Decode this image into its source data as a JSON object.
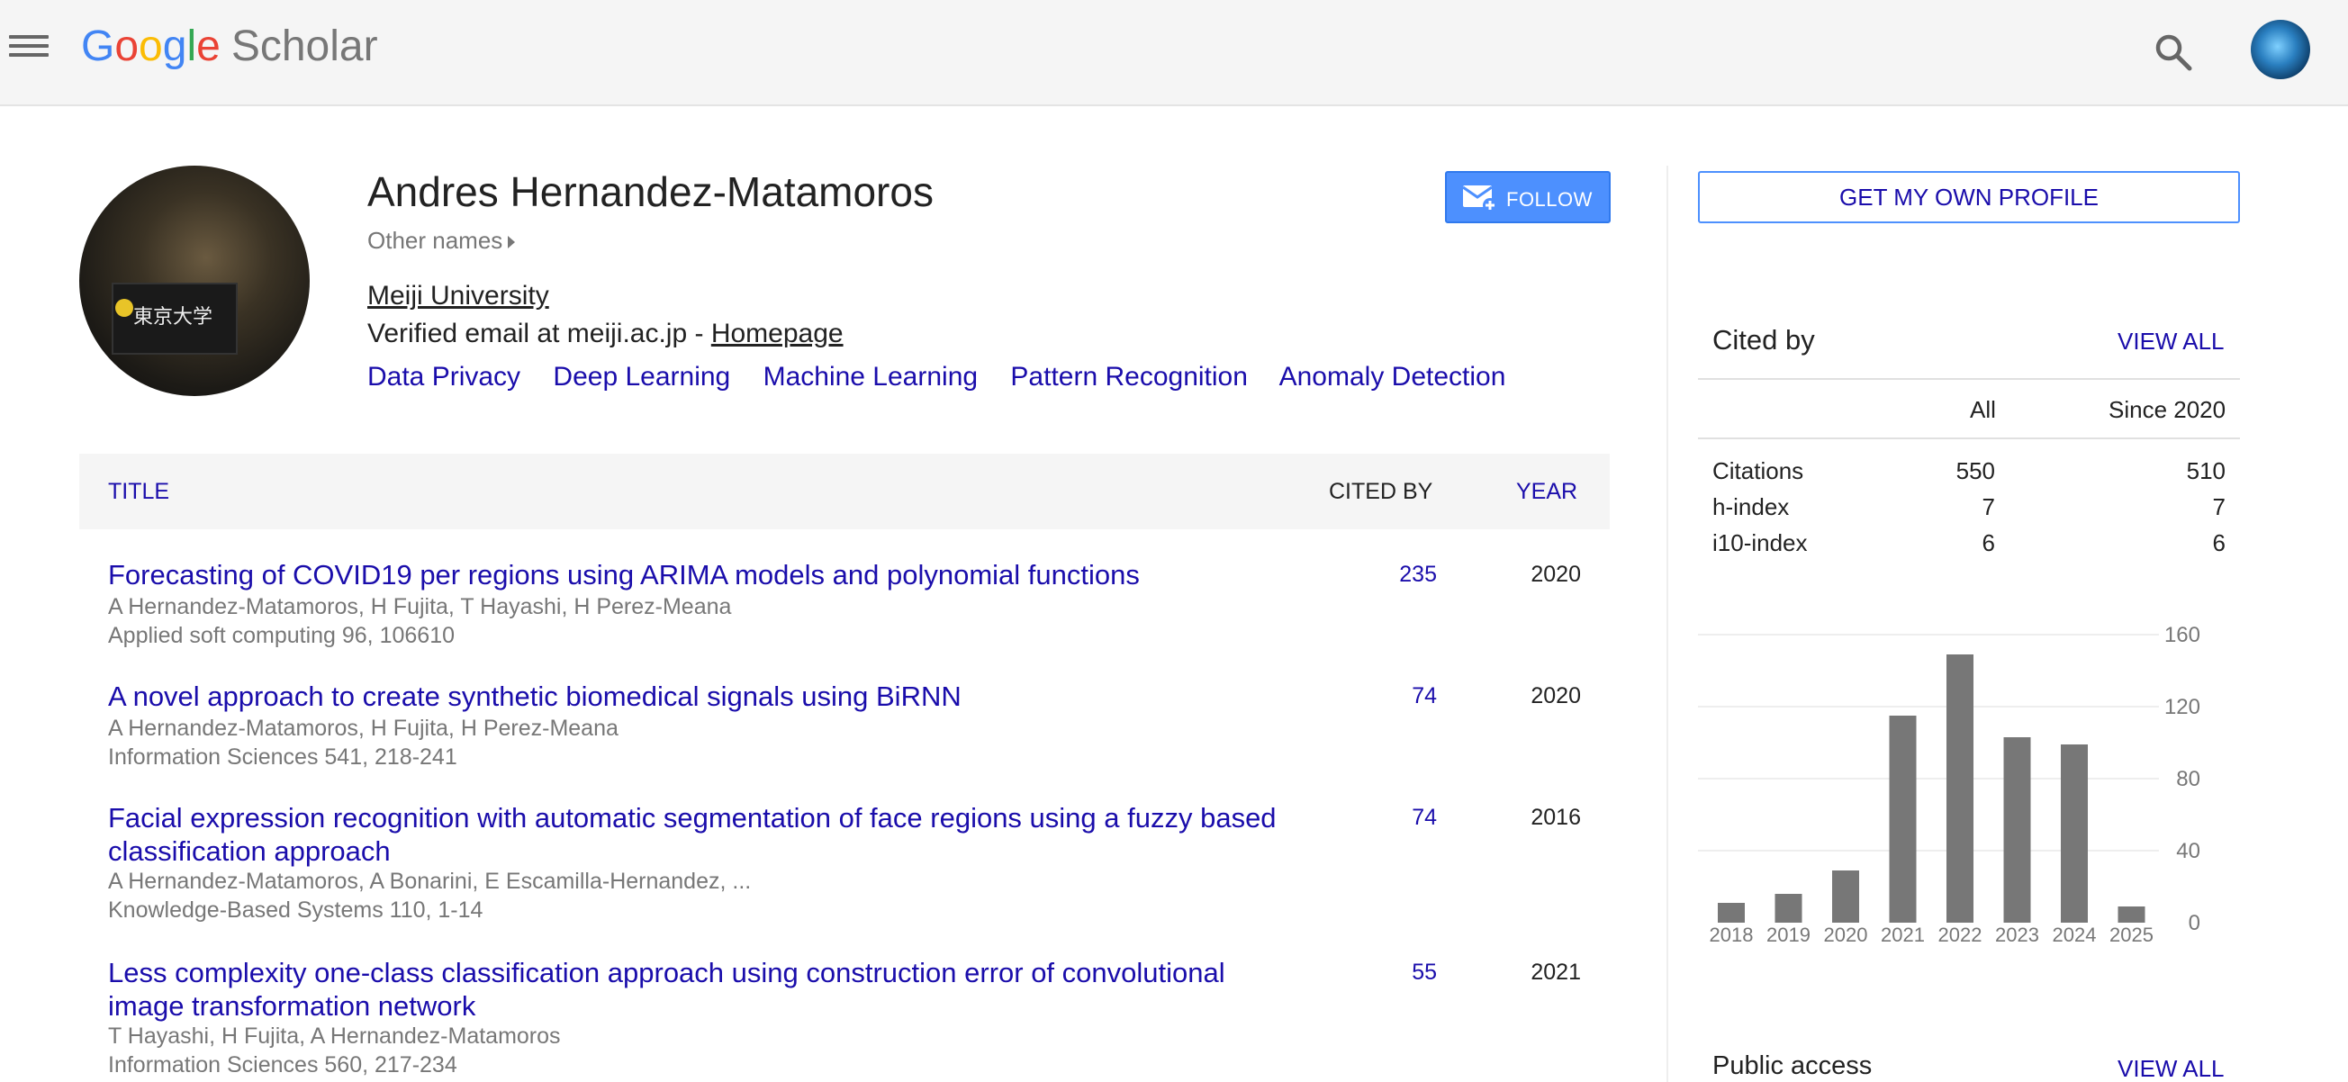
{
  "header": {
    "logo_letters": [
      "G",
      "o",
      "o",
      "g",
      "l",
      "e"
    ],
    "logo_product": "Scholar",
    "icons": [
      "menu-icon",
      "search-icon",
      "account-avatar"
    ]
  },
  "profile": {
    "name": "Andres Hernandez-Matamoros",
    "other_names_label": "Other names",
    "affiliation": "Meiji University",
    "email_text": "Verified email at meiji.ac.jp - ",
    "homepage_label": "Homepage",
    "interests": [
      "Data Privacy",
      "Deep Learning",
      "Machine Learning",
      "Pattern Recognition",
      "Anomaly Detection"
    ],
    "follow_label": "FOLLOW",
    "photo_sign_text": "東京大学"
  },
  "table": {
    "headers": {
      "title": "TITLE",
      "cited_by": "CITED BY",
      "year": "YEAR"
    },
    "rows": [
      {
        "title": "Forecasting of COVID19 per regions using ARIMA models and polynomial functions",
        "authors": "A Hernandez-Matamoros, H Fujita, T Hayashi, H Perez-Meana",
        "venue": "Applied soft computing 96, 106610",
        "cited_by": "235",
        "year": "2020"
      },
      {
        "title": "A novel approach to create synthetic biomedical signals using BiRNN",
        "authors": "A Hernandez-Matamoros, H Fujita, H Perez-Meana",
        "venue": "Information Sciences 541, 218-241",
        "cited_by": "74",
        "year": "2020"
      },
      {
        "title": "Facial expression recognition with automatic segmentation of face regions using a fuzzy based classification approach",
        "authors": "A Hernandez-Matamoros, A Bonarini, E Escamilla-Hernandez, ...",
        "venue": "Knowledge-Based Systems 110, 1-14",
        "cited_by": "74",
        "year": "2016"
      },
      {
        "title": "Less complexity one-class classification approach using construction error of convolutional image transformation network",
        "authors": "T Hayashi, H Fujita, A Hernandez-Matamoros",
        "venue": "Information Sciences 560, 217-234",
        "cited_by": "55",
        "year": "2021"
      }
    ]
  },
  "sidebar": {
    "own_profile_label": "GET MY OWN PROFILE",
    "cited_by": {
      "title": "Cited by",
      "view_all": "VIEW ALL",
      "col_all": "All",
      "col_since": "Since 2020",
      "stats": [
        {
          "label": "Citations",
          "all": "550",
          "since": "510"
        },
        {
          "label": "h-index",
          "all": "7",
          "since": "7"
        },
        {
          "label": "i10-index",
          "all": "6",
          "since": "6"
        }
      ]
    },
    "public_access": {
      "title": "Public access",
      "view_all": "VIEW ALL"
    }
  },
  "chart_data": {
    "type": "bar",
    "categories": [
      "2018",
      "2019",
      "2020",
      "2021",
      "2022",
      "2023",
      "2024",
      "2025"
    ],
    "values": [
      11,
      16,
      29,
      115,
      149,
      103,
      99,
      9
    ],
    "title": "",
    "xlabel": "",
    "ylabel": "",
    "ylim": [
      0,
      160
    ],
    "yticks": [
      0,
      40,
      80,
      120,
      160
    ],
    "bar_color": "#777777",
    "grid": true
  }
}
